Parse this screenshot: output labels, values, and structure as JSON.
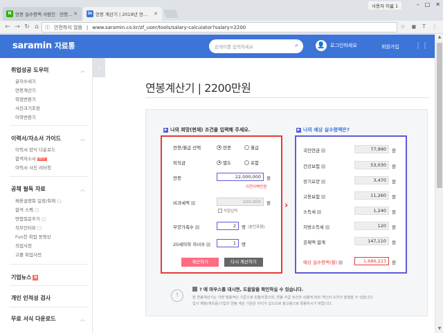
{
  "browser": {
    "tabs": [
      {
        "title": "연봉 실수령액 사람인 · 연봉…",
        "favicon": "N",
        "color": "#2db400"
      },
      {
        "title": "연봉 계산기 | 2018년 연…",
        "favicon": "in",
        "color": "#3d74d8"
      }
    ],
    "user_chip": "사용자 이름 1",
    "security_label": "안전하지 않음",
    "url": "www.saramin.co.kr/zf_user/tools/salary-calculator?salary=2200"
  },
  "header": {
    "logo": "saramin",
    "logo_sub": "자료통",
    "search_placeholder": "검색어를 입력하세요",
    "login_label": "로그인하세요",
    "join_label": "회원가입"
  },
  "sidebar": {
    "sections": [
      {
        "title": "취업성공 도우미",
        "items": [
          "글자수세기",
          "연봉계산기",
          "학점변환기",
          "사진크기조정",
          "어학변환기"
        ]
      },
      {
        "title": "이력서/자소서 가이드",
        "items": [
          "이력서 양식 다운로드",
          "합격자소서",
          "이력서 사진 리터칭"
        ],
        "hot_label": "HOT"
      },
      {
        "title": "공채 필독 자료",
        "items": [
          "채용설명회 일정/취재",
          "합격 스펙",
          "면접질문후기",
          "직무인터뷰",
          "Fun한 취업 동영상",
          "직업사전",
          "고졸 취업사전"
        ]
      },
      {
        "title": "기업뉴스",
        "badge": "N"
      },
      {
        "title": "개인 인적성 검사"
      },
      {
        "title": "무료 서식 다운로드"
      }
    ]
  },
  "main": {
    "title": "연봉계산기 | 2200만원",
    "left_panel_label": "나의 희망(현재) 조건을 입력해 주세요.",
    "right_panel_label": "나의 예상 실수령액은?",
    "form": {
      "salary_type_label": "연봉/월급 선택",
      "salary_type_options": [
        "연봉",
        "월급"
      ],
      "severance_label": "퇴직금",
      "severance_options": [
        "별도",
        "포함"
      ],
      "salary_label": "연봉",
      "salary_value": "22,000,000",
      "unit_won": "원",
      "hangul_link": "이천이백만원",
      "nontax_label": "비과세액",
      "nontax_value": "100,000",
      "direct_input_label": "직접입력",
      "dependents_label": "부양가족수",
      "dependents_value": "2",
      "dependents_unit": "명",
      "dependents_note": "(본인포함)",
      "children_label": "20세이하 자녀수",
      "children_value": "1",
      "children_unit": "명",
      "calc_button": "계산하기",
      "recalc_button": "다시 계산하기"
    },
    "results": [
      {
        "label": "국민연금",
        "value": "77,990"
      },
      {
        "label": "건강보험",
        "value": "53,030"
      },
      {
        "label": "장기요양",
        "value": "3,470"
      },
      {
        "label": "고용보험",
        "value": "11,260"
      },
      {
        "label": "소득세",
        "value": "1,240"
      },
      {
        "label": "지방소득세",
        "value": "120"
      },
      {
        "label": "공제액 합계",
        "value": "147,110"
      },
      {
        "label": "예상 실수령액(월)",
        "value": "1,686,223"
      }
    ],
    "result_unit": "원",
    "note_title": "? 에 마우스를 대시면, 도움말을 확인하실 수 있습니다.",
    "note_lines": [
      "본 연봉계산기는 가장 범용적인 기준으로 만들어졌으며, 연봉 지급 조건과 상황에 따라 약간의 오차가 발생할 수 있습니다.",
      "입사 예정(재직중)기업의 연봉 계산 기준은 차이가 있으므로 참고용으로 활용하시기 바랍니다."
    ]
  }
}
